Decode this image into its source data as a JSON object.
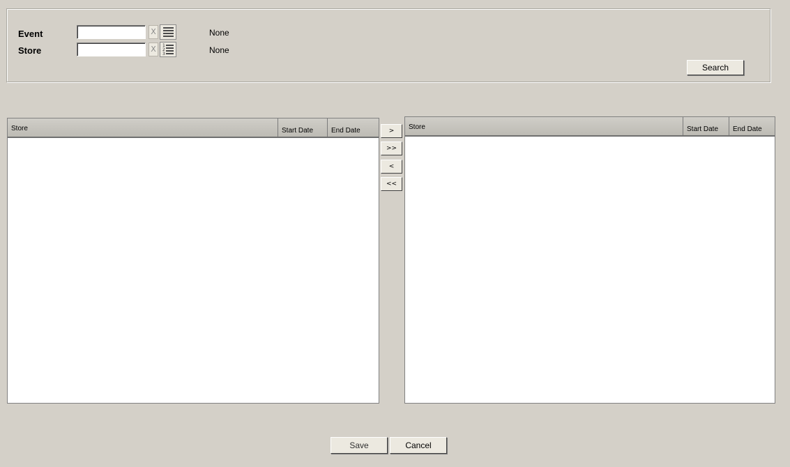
{
  "criteria": {
    "event": {
      "label": "Event",
      "value": "",
      "clear_label": "X",
      "selected_text": "None"
    },
    "store": {
      "label": "Store",
      "value": "",
      "clear_label": "X",
      "selected_text": "None"
    },
    "search_label": "Search"
  },
  "available_grid": {
    "columns": [
      "Store",
      "Start Date",
      "End Date"
    ],
    "rows": []
  },
  "selected_grid": {
    "columns": [
      "Store",
      "Start Date",
      "End Date"
    ],
    "rows": []
  },
  "move_buttons": {
    "add_one": ">",
    "add_all": ">>",
    "remove_one": "<",
    "remove_all": "<<"
  },
  "footer": {
    "save_label": "Save",
    "cancel_label": "Cancel"
  },
  "icons": {
    "clear": "clear-x-icon",
    "list_lookup": "list-lookup-icon",
    "numbered_list_lookup": "numbered-list-lookup-icon"
  },
  "colors": {
    "background": "#d4d0c8",
    "grid_header": "#c8c6c0",
    "grid_body": "#ffffff"
  }
}
